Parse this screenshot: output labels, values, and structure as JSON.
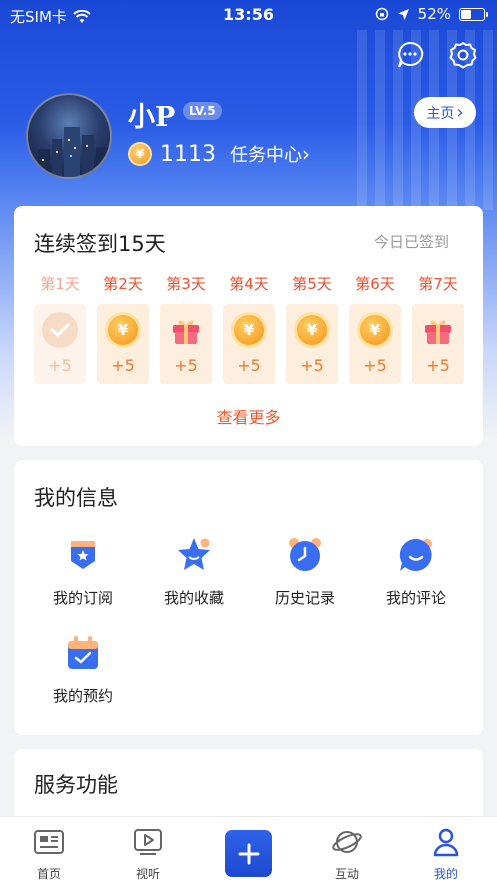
{
  "status_bar": {
    "carrier": "无SIM卡",
    "time": "13:56",
    "battery_percent": 52,
    "battery_text": "52%"
  },
  "header": {
    "message_icon": "chat-bubble-icon",
    "settings_icon": "gear-icon"
  },
  "profile": {
    "username": "小P",
    "level": "LV.5",
    "home_button": "主页",
    "coins": "1113",
    "coin_symbol": "¥",
    "task_center": "任务中心",
    "chevron": "›"
  },
  "checkin": {
    "title": "连续签到15天",
    "status": "今日已签到",
    "more": "查看更多",
    "days": [
      {
        "label": "第1天",
        "reward": "+5",
        "icon": "check-icon",
        "done": true
      },
      {
        "label": "第2天",
        "reward": "+5",
        "icon": "coin-icon",
        "done": false
      },
      {
        "label": "第3天",
        "reward": "+5",
        "icon": "gift-icon",
        "done": false
      },
      {
        "label": "第4天",
        "reward": "+5",
        "icon": "coin-icon",
        "done": false
      },
      {
        "label": "第5天",
        "reward": "+5",
        "icon": "coin-icon",
        "done": false
      },
      {
        "label": "第6天",
        "reward": "+5",
        "icon": "coin-icon",
        "done": false
      },
      {
        "label": "第7天",
        "reward": "+5",
        "icon": "gift-icon",
        "done": false
      }
    ]
  },
  "my_info": {
    "title": "我的信息",
    "items": [
      {
        "label": "我的订阅",
        "icon": "subscription-icon"
      },
      {
        "label": "我的收藏",
        "icon": "star-icon"
      },
      {
        "label": "历史记录",
        "icon": "clock-icon"
      },
      {
        "label": "我的评论",
        "icon": "comment-icon"
      },
      {
        "label": "我的预约",
        "icon": "calendar-icon"
      }
    ]
  },
  "services": {
    "title": "服务功能"
  },
  "tabbar": {
    "items": [
      {
        "label": "首页",
        "icon": "news-icon",
        "active": false
      },
      {
        "label": "视听",
        "icon": "play-icon",
        "active": false
      },
      {
        "label": "",
        "icon": "plus-icon",
        "active": false
      },
      {
        "label": "互动",
        "icon": "planet-icon",
        "active": false
      },
      {
        "label": "我的",
        "icon": "person-icon",
        "active": true
      }
    ]
  },
  "colors": {
    "brand_blue": "#2b55d8",
    "accent_orange": "#f05a2d",
    "coin_gold": "#f49419"
  }
}
